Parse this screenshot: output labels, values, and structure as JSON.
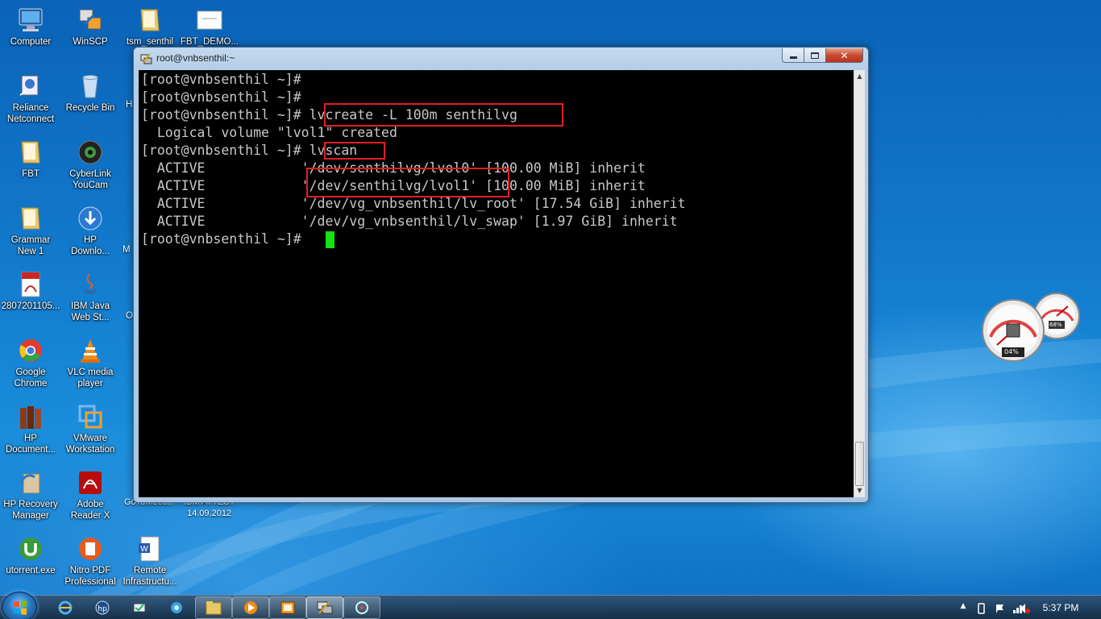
{
  "desktop": {
    "icons": [
      {
        "id": "computer",
        "label": "Computer"
      },
      {
        "id": "winscp",
        "label": "WinSCP"
      },
      {
        "id": "tsm",
        "label": "tsm_senthil"
      },
      {
        "id": "fbtdemo",
        "label": "FBT_DEMO..."
      },
      {
        "id": "reliance",
        "label": "Reliance\nNetconnect"
      },
      {
        "id": "recycle",
        "label": "Recycle Bin"
      },
      {
        "id": "fbt",
        "label": "FBT"
      },
      {
        "id": "cyberlink",
        "label": "CyberLink\nYouCam"
      },
      {
        "id": "grammar",
        "label": "Grammar\nNew 1"
      },
      {
        "id": "hpdownload",
        "label": "HP\nDownlo..."
      },
      {
        "id": "pdf",
        "label": "2807201105..."
      },
      {
        "id": "ibmjava",
        "label": "IBM Java\nWeb St..."
      },
      {
        "id": "chrome",
        "label": "Google\nChrome"
      },
      {
        "id": "vlc",
        "label": "VLC media\nplayer"
      },
      {
        "id": "hpdoc",
        "label": "HP\nDocument..."
      },
      {
        "id": "vmware",
        "label": "VMware\nWorkstation"
      },
      {
        "id": "hprecovery",
        "label": "HP Recovery\nManager"
      },
      {
        "id": "adobe",
        "label": "Adobe\nReader X"
      },
      {
        "id": "utorrent",
        "label": "utorrent.exe"
      },
      {
        "id": "nitro",
        "label": "Nitro PDF\nProfessional"
      },
      {
        "id": "remote",
        "label": "Remote\nInfrastructu..."
      }
    ],
    "partial_labels": {
      "h": "H",
      "m": "M",
      "o": "O",
      "under_window_1": "GoToMeeti...",
      "under_window_2": "IBM ATTEST",
      "under_window_3": "14.09.2012"
    }
  },
  "window": {
    "title": "root@vnbsenthil:~",
    "minimize_label": "–",
    "maximize_label": "□",
    "close_label": "✕"
  },
  "terminal": {
    "lines": [
      "[root@vnbsenthil ~]#",
      "[root@vnbsenthil ~]#",
      "[root@vnbsenthil ~]# lvcreate -L 100m senthilvg",
      "  Logical volume \"lvol1\" created",
      "[root@vnbsenthil ~]# lvscan",
      "  ACTIVE            '/dev/senthilvg/lvol0' [100.00 MiB] inherit",
      "  ACTIVE            '/dev/senthilvg/lvol1' [100.00 MiB] inherit",
      "  ACTIVE            '/dev/vg_vnbsenthil/lv_root' [17.54 GiB] inherit",
      "  ACTIVE            '/dev/vg_vnbsenthil/lv_swap' [1.97 GiB] inherit",
      "[root@vnbsenthil ~]# "
    ],
    "text_color": "#c8c8c8",
    "cursor_color": "#16e016",
    "highlight_color": "#e02020"
  },
  "gadget": {
    "cpu_percent": "04%",
    "memory_percent": "68%",
    "cpu_value": 0.04,
    "memory_value": 0.68
  },
  "taskbar": {
    "clock": "5:37 PM",
    "tray_arrow": "▲"
  },
  "colors": {
    "accent": "#1279cc",
    "titlebar": "#b3cde6"
  }
}
